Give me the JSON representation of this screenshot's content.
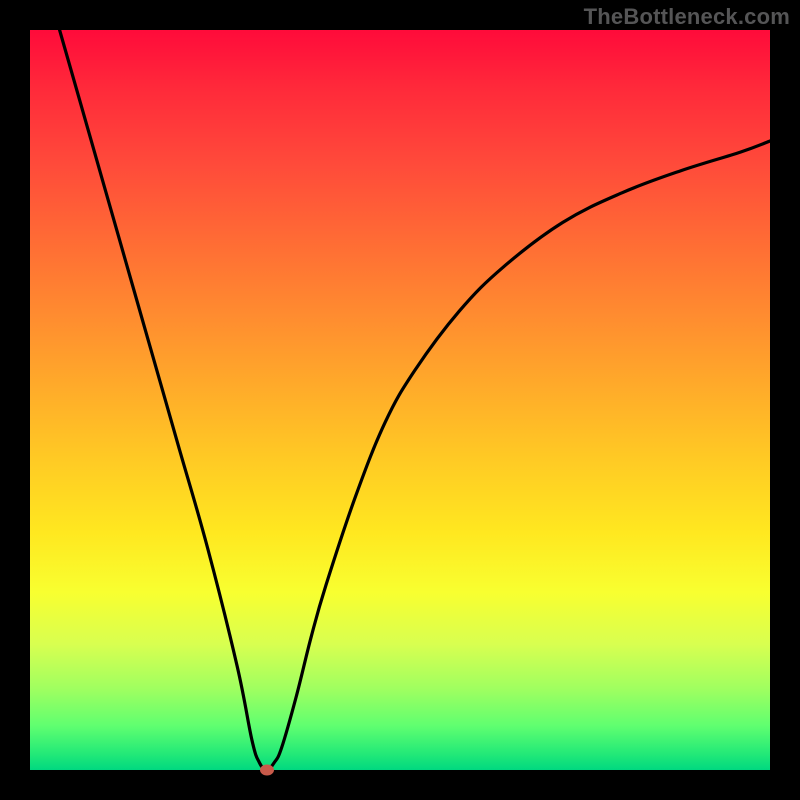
{
  "watermark": "TheBottleneck.com",
  "chart_data": {
    "type": "line",
    "title": "",
    "xlabel": "",
    "ylabel": "",
    "xlim": [
      0,
      100
    ],
    "ylim": [
      0,
      100
    ],
    "grid": false,
    "series": [
      {
        "name": "curve",
        "x": [
          4,
          8,
          12,
          16,
          20,
          24,
          28,
          30,
          31,
          32,
          33,
          34,
          36,
          38,
          40,
          44,
          48,
          52,
          58,
          64,
          72,
          80,
          88,
          96,
          100
        ],
        "y": [
          100,
          86,
          72,
          58,
          44,
          30,
          14,
          4,
          1,
          0,
          1,
          3,
          10,
          18,
          25,
          37,
          47,
          54,
          62,
          68,
          74,
          78,
          81,
          83.5,
          85
        ]
      }
    ],
    "marker": {
      "x": 32,
      "y": 0
    },
    "colors": {
      "line": "#000000",
      "marker": "#c85a4a",
      "background_gradient": [
        "#ff0b3a",
        "#ffaa2a",
        "#ffe820",
        "#00d880"
      ],
      "frame": "#000000"
    }
  }
}
